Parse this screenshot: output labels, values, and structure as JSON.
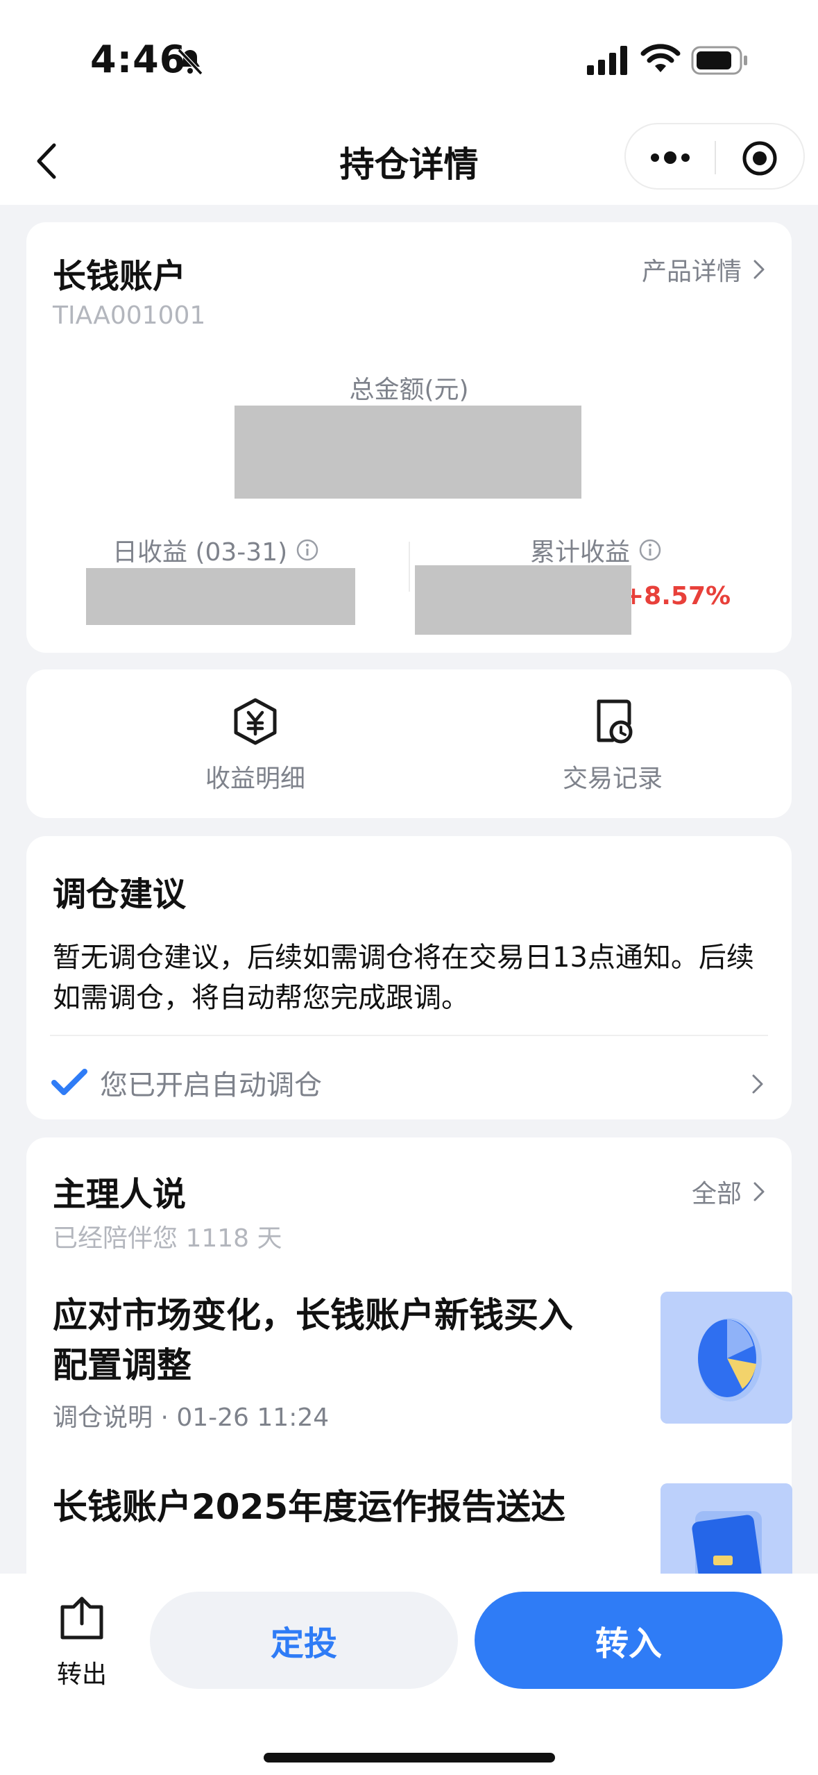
{
  "status_bar": {
    "time": "4:46"
  },
  "nav": {
    "title": "持仓详情"
  },
  "account_card": {
    "name": "长钱账户",
    "code": "TIAA001001",
    "product_link": "产品详情",
    "total_label": "总金额(元)",
    "daily_label": "日收益 (03-31)",
    "cumulative_label": "累计收益",
    "cumulative_pct": "+8.57%"
  },
  "actions": {
    "income_detail": "收益明细",
    "trade_records": "交易记录"
  },
  "rebalance": {
    "title": "调仓建议",
    "notice": "暂无调仓建议，后续如需调仓将在交易日13点通知。后续如需调仓，将自动帮您完成跟调。",
    "auto_status": "您已开启自动调仓"
  },
  "manager": {
    "title": "主理人说",
    "all_link": "全部",
    "accompany": "已经陪伴您 1118 天",
    "articles": [
      {
        "title": "应对市场变化，长钱账户新钱买入配置调整",
        "meta": "调仓说明 · 01-26 11:24"
      },
      {
        "title": "长钱账户2025年度运作报告送达"
      }
    ]
  },
  "bottom": {
    "transfer_out": "转出",
    "sip_button": "定投",
    "transfer_in_button": "转入"
  },
  "colors": {
    "accent_blue": "#2f7cf6",
    "gain_red": "#e8403a",
    "muted_text": "#7e828b",
    "page_bg": "#f2f3f6"
  }
}
